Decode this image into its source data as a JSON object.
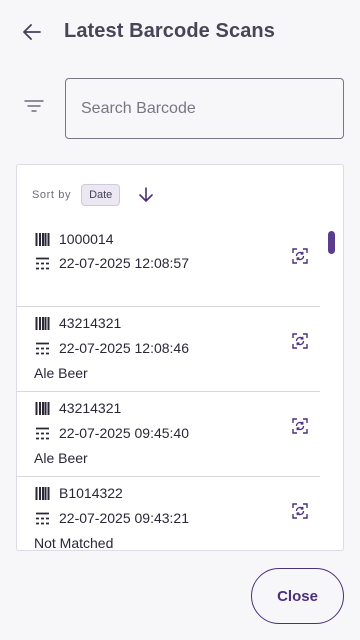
{
  "header": {
    "title": "Latest Barcode Scans"
  },
  "search": {
    "placeholder": "Search Barcode",
    "value": ""
  },
  "sort": {
    "label": "Sort by",
    "field": "Date",
    "direction": "descending"
  },
  "items": [
    {
      "barcode": "1000014",
      "datetime": "22-07-2025 12:08:57",
      "match": ""
    },
    {
      "barcode": "43214321",
      "datetime": "22-07-2025 12:08:46",
      "match": "Ale Beer"
    },
    {
      "barcode": "43214321",
      "datetime": "22-07-2025 09:45:40",
      "match": "Ale Beer"
    },
    {
      "barcode": "B1014322",
      "datetime": "22-07-2025 09:43:21",
      "match": "Not Matched"
    }
  ],
  "footer": {
    "close_label": "Close"
  },
  "colors": {
    "accent": "#4b2f7d",
    "background": "#f7f6f9",
    "panel": "#ffffff"
  }
}
